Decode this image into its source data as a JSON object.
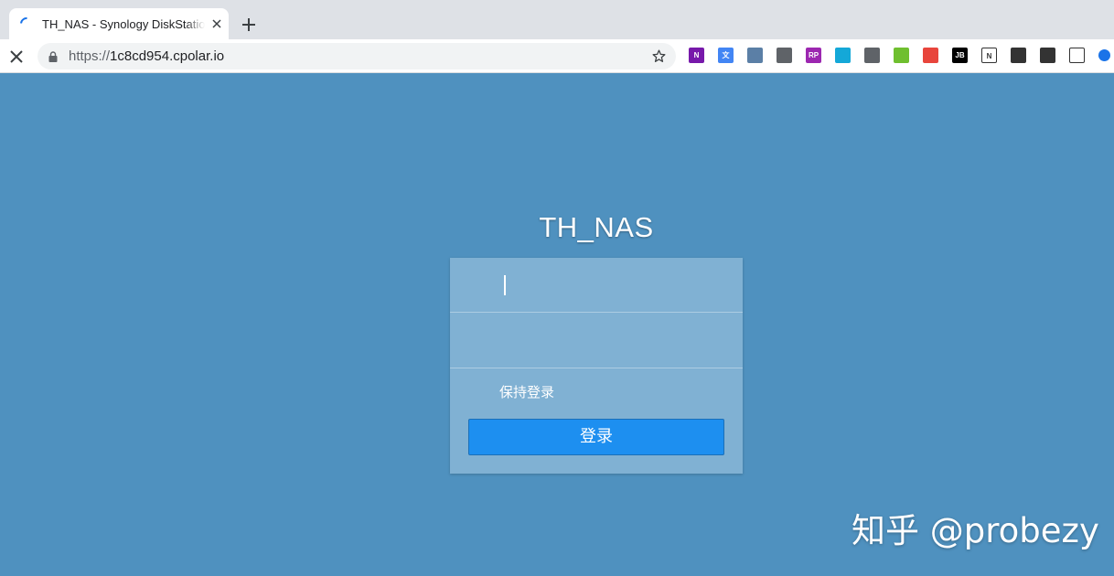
{
  "browser": {
    "tab": {
      "title": "TH_NAS - Synology DiskStation"
    },
    "address": {
      "scheme": "https://",
      "host": "1c8cd954.cpolar.io"
    },
    "extensions": [
      {
        "name": "onenote-icon",
        "color": "#7719aa",
        "text": "N"
      },
      {
        "name": "translate-icon",
        "color": "#4285f4",
        "text": "文"
      },
      {
        "name": "extension-globe-icon",
        "color": "#5b7fa6",
        "text": ""
      },
      {
        "name": "extension-mask-icon",
        "color": "#5f6368",
        "text": ""
      },
      {
        "name": "rp-icon",
        "color": "#9c27b0",
        "text": "RP"
      },
      {
        "name": "refresh-extension-icon",
        "color": "#14a8d8",
        "text": ""
      },
      {
        "name": "hand-extension-icon",
        "color": "#5f6368",
        "text": ""
      },
      {
        "name": "download-extension-icon",
        "color": "#6fbf2f",
        "text": ""
      },
      {
        "name": "asterisk-extension-icon",
        "color": "#e8453c",
        "text": ""
      },
      {
        "name": "jetbrains-icon",
        "color": "#000000",
        "text": "JB"
      },
      {
        "name": "notion-icon",
        "color": "#ffffff",
        "text": "N"
      },
      {
        "name": "qr-code-icon",
        "color": "#333333",
        "text": ""
      },
      {
        "name": "qr-code-icon-2",
        "color": "#333333",
        "text": ""
      },
      {
        "name": "shield-extension-icon",
        "color": "#ffffff",
        "text": ""
      },
      {
        "name": "check-extension-icon",
        "color": "#1a73e8",
        "text": ""
      }
    ]
  },
  "login": {
    "server_name": "TH_NAS",
    "username_value": "",
    "password_value": "",
    "remember_label": "保持登录",
    "login_button": "登录"
  },
  "watermark": "知乎 @probezy",
  "colors": {
    "page_bg": "#4f91bf",
    "card_bg": "#80b1d3",
    "button_bg": "#1d8ff0"
  }
}
